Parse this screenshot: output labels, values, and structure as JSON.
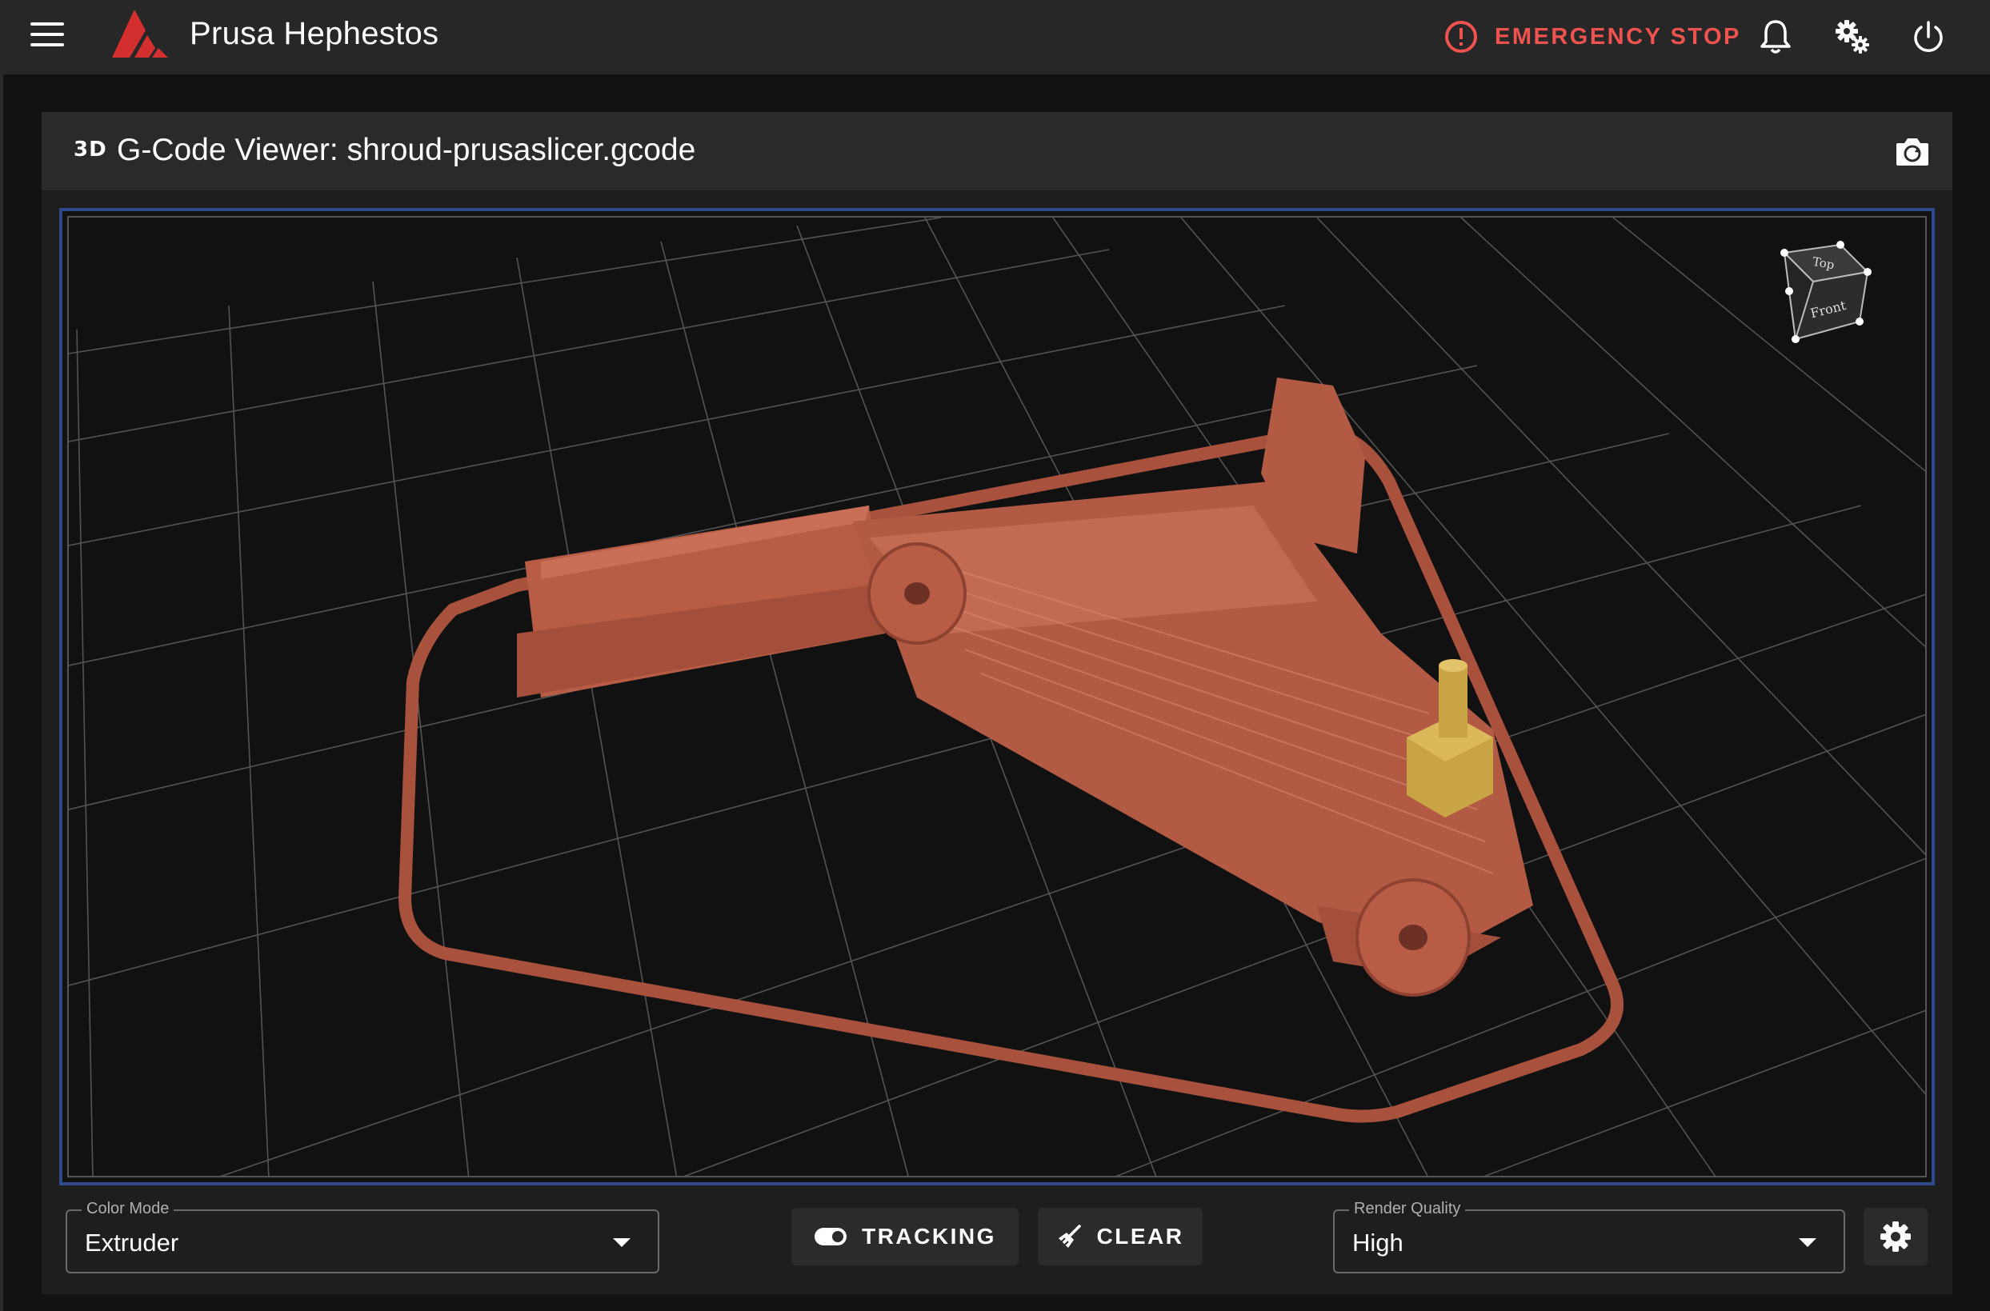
{
  "app": {
    "title": "Prusa Hephestos",
    "brand_color": "#d32f2f"
  },
  "topbar": {
    "menu_icon": "hamburger-menu-icon",
    "emergency_stop_label": "EMERGENCY STOP",
    "emergency_color": "#ef5350",
    "icons": [
      "bell-icon",
      "gears-icon",
      "power-icon"
    ]
  },
  "viewer_card": {
    "badge": "3D",
    "title": "G-Code Viewer: shroud-prusaslicer.gcode",
    "camera_icon": "camera-reset-icon",
    "view_cube": {
      "top_label": "Top",
      "front_label": "Front"
    },
    "model_color": "#b85c45",
    "nozzle_color": "#c9a445",
    "viewport_border": "#2e4a8a"
  },
  "controls": {
    "color_mode": {
      "label": "Color Mode",
      "value": "Extruder"
    },
    "tracking_label": "TRACKING",
    "clear_label": "CLEAR",
    "render_quality": {
      "label": "Render Quality",
      "value": "High"
    },
    "settings_icon": "gear-icon"
  }
}
